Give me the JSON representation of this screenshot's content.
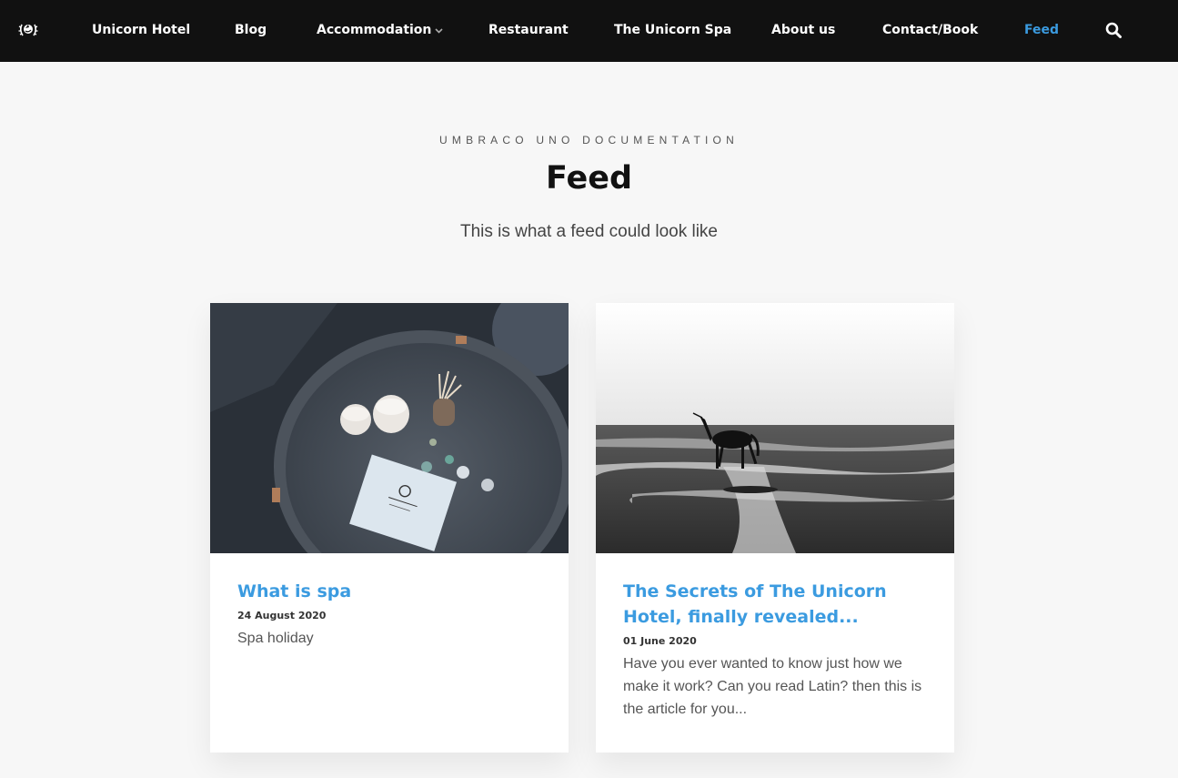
{
  "nav": {
    "logo_icon": "unicorn-wreath-logo",
    "items": [
      {
        "label": "Unicorn Hotel"
      },
      {
        "label": "Blog"
      },
      {
        "label": "Accommodation"
      },
      {
        "label": "Restaurant"
      },
      {
        "label": "The Unicorn Spa"
      },
      {
        "label": "About us"
      },
      {
        "label": "Contact/Book"
      },
      {
        "label": "Feed"
      }
    ],
    "active_item": "Feed",
    "search_icon": "search-icon",
    "active_color": "#3b9be0"
  },
  "hero": {
    "eyebrow": "UMBRACO UNO DOCUMENTATION",
    "title": "Feed",
    "subtitle": "This is what a feed could look like"
  },
  "cards": [
    {
      "title": "What is spa",
      "date": "24 August 2020",
      "excerpt": "Spa holiday",
      "image": "spa-tray-with-candles-and-card-photo"
    },
    {
      "title": "The Secrets of The Unicorn Hotel, finally revealed...",
      "date": "01 June 2020",
      "excerpt": "Have you ever wanted to know just how we make it work? Can you read Latin? then this is the article for you...",
      "image": "unicorn-on-beach-photo"
    }
  ]
}
